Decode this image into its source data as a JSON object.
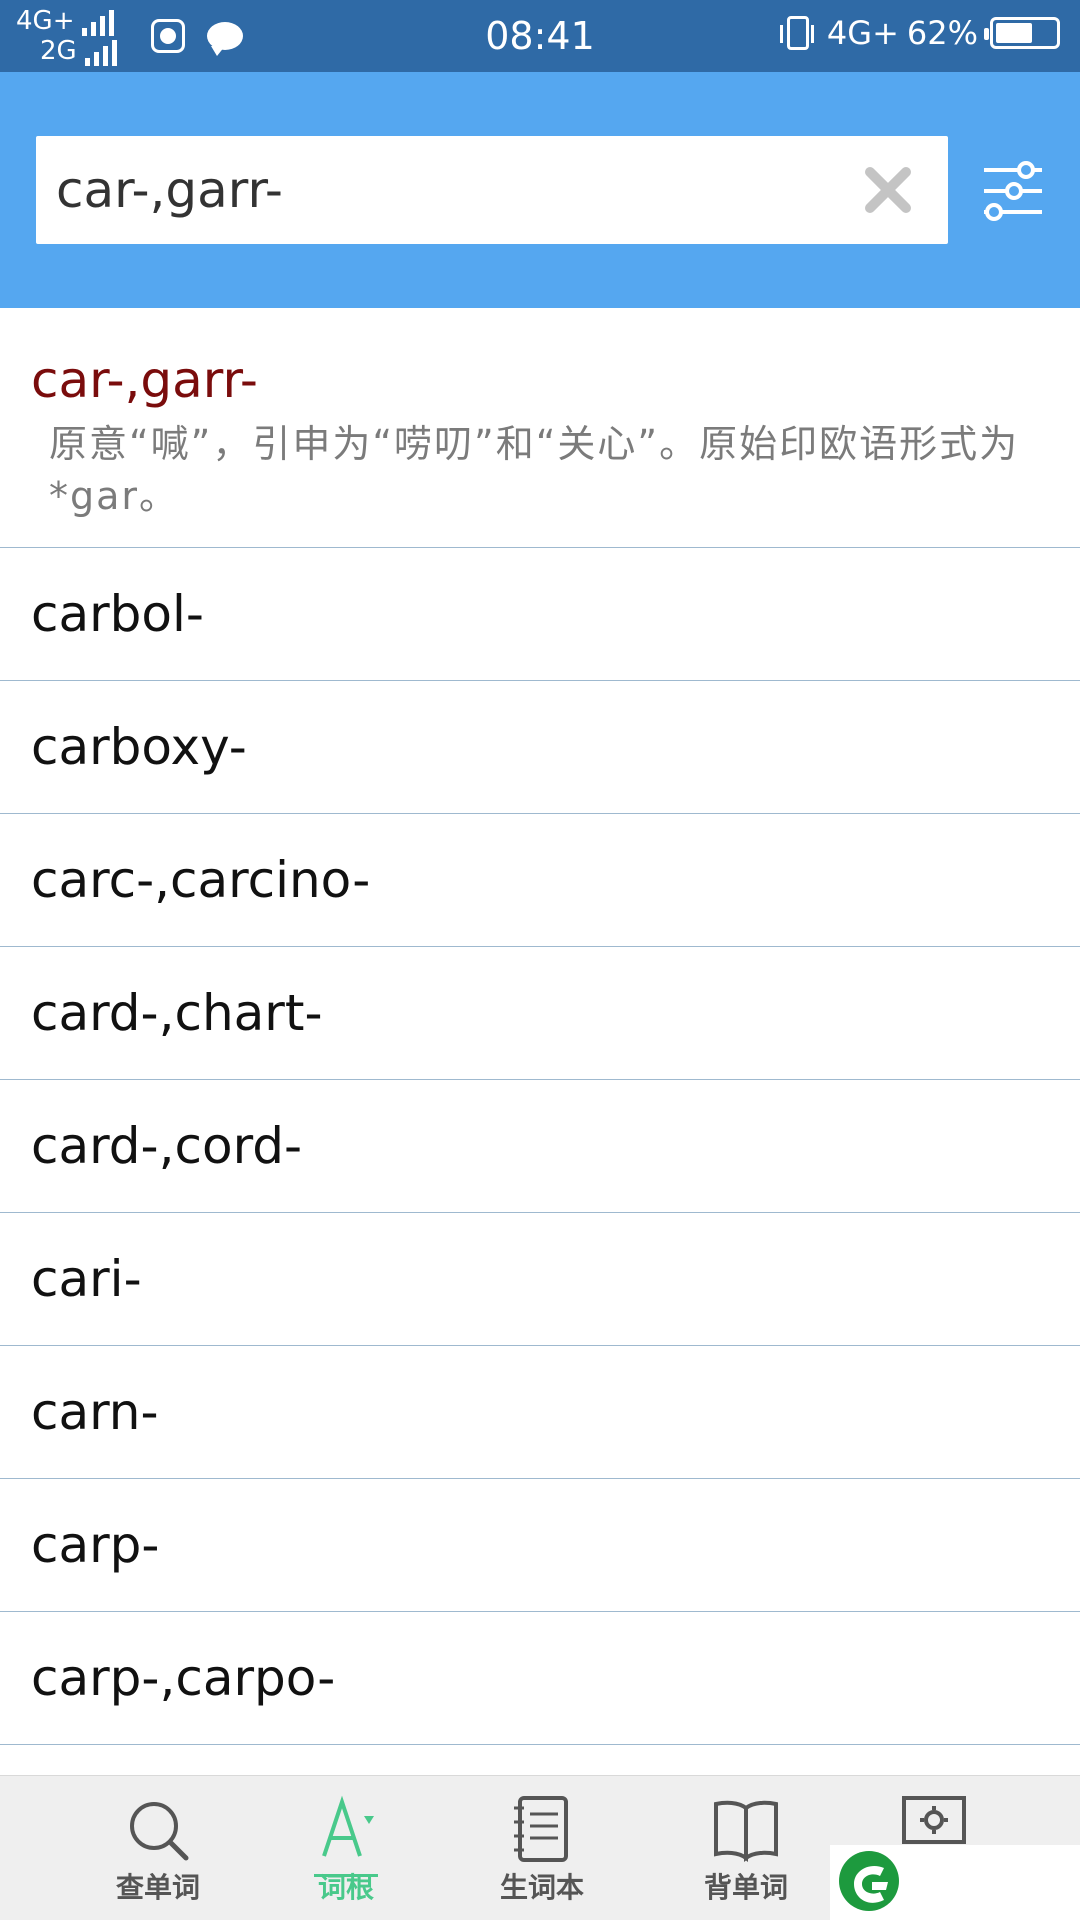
{
  "status_bar": {
    "network_top": "4G+",
    "network_bottom": "2G",
    "time": "08:41",
    "right_network": "4G+",
    "battery": "62%",
    "battery_level": 0.62
  },
  "search": {
    "value": "car-,garr-",
    "clear_icon": "close-x-icon",
    "filter_icon": "sliders-icon"
  },
  "results": {
    "featured": {
      "title": "car-,garr-",
      "description": "原意“喊”，引申为“唠叨”和“关心”。原始印欧语形式为 *gar。"
    },
    "items": [
      "carbol-",
      "carboxy-",
      "carc-,carcino-",
      "card-,chart-",
      "card-,cord-",
      "cari-",
      "carn-",
      "carp-",
      "carp-,carpo-"
    ]
  },
  "bottom_nav": {
    "items": [
      {
        "label": "查单词",
        "icon": "search-icon"
      },
      {
        "label": "词根",
        "icon": "word-root-icon"
      },
      {
        "label": "生词本",
        "icon": "notebook-icon"
      },
      {
        "label": "背单词",
        "icon": "book-icon"
      },
      {
        "label": "",
        "icon": "settings-icon"
      }
    ],
    "active_index": 1
  },
  "colors": {
    "status_bar": "#2f6aa6",
    "header": "#55a7f0",
    "featured_title": "#7a0c0c",
    "active_tab": "#49c98b",
    "divider": "#9fb9cf"
  }
}
